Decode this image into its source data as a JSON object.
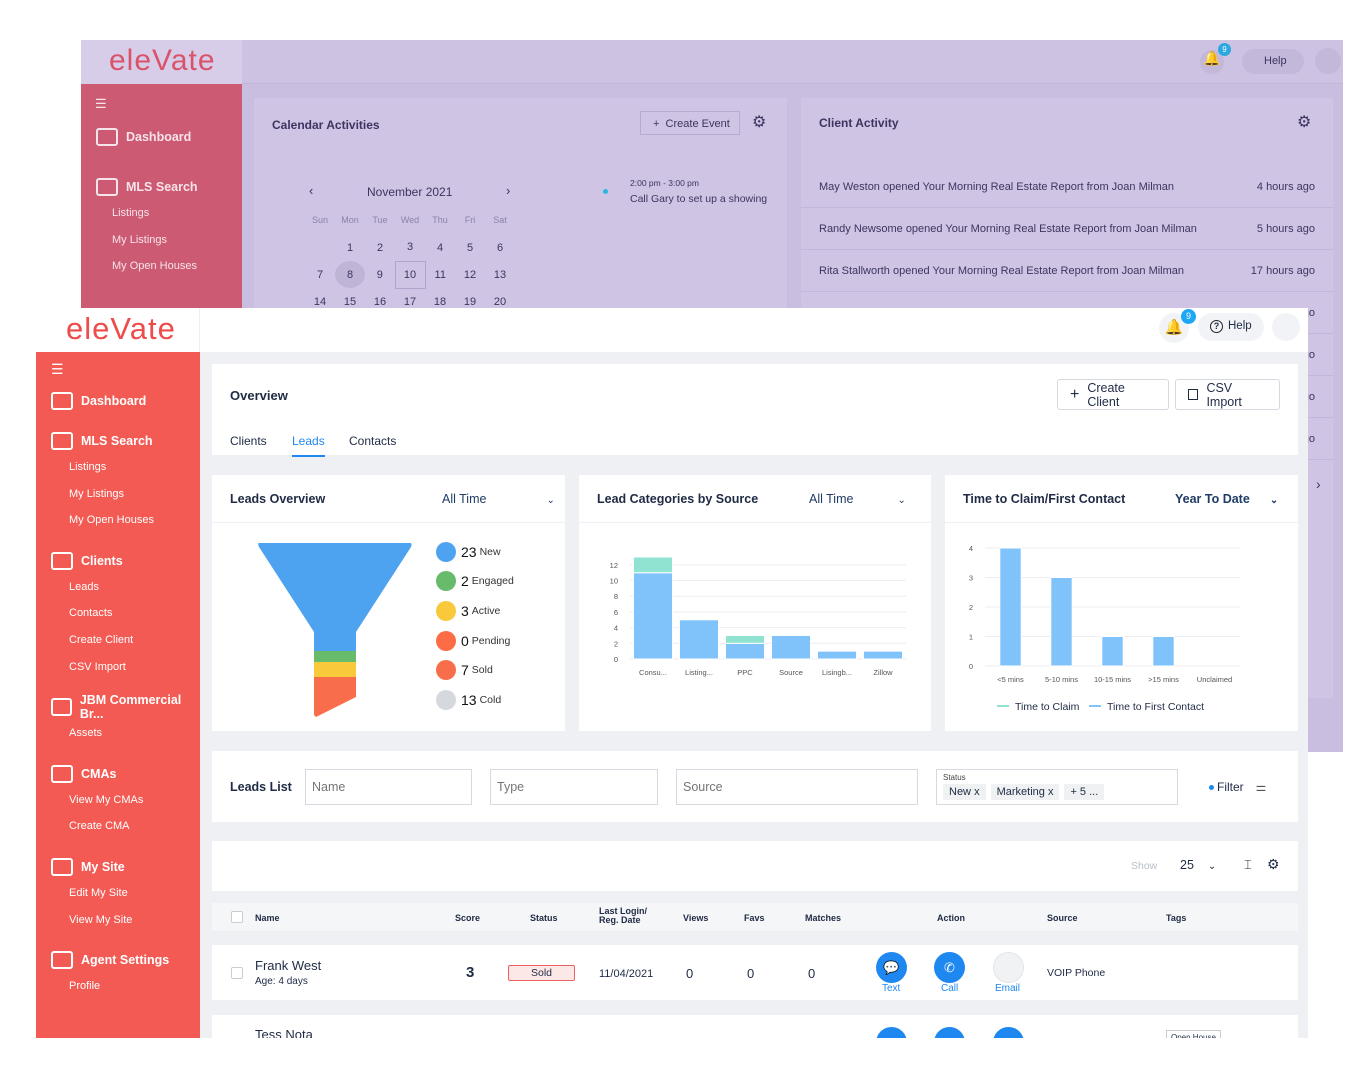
{
  "background_window": {
    "logo": "eleVate",
    "notifications": "9",
    "help": "Help",
    "sidebar": {
      "dashboard": "Dashboard",
      "mls": "MLS Search",
      "items": [
        "Listings",
        "My Listings",
        "My Open Houses"
      ]
    },
    "calendar": {
      "title": "Calendar Activities",
      "create_event": "Create Event",
      "month": "November 2021",
      "weekdays": [
        "Sun",
        "Mon",
        "Tue",
        "Wed",
        "Thu",
        "Fri",
        "Sat"
      ],
      "weeks": [
        [
          "",
          "1",
          "2",
          "3",
          "4",
          "5",
          "6"
        ],
        [
          "7",
          "8",
          "9",
          "10",
          "11",
          "12",
          "13"
        ],
        [
          "14",
          "15",
          "16",
          "17",
          "18",
          "19",
          "20"
        ]
      ],
      "event_time": "2:00 pm - 3:00 pm",
      "event_text": "Call Gary to set up a showing"
    },
    "client_activity": {
      "title": "Client Activity",
      "rows": [
        {
          "text": "May Weston opened Your Morning Real Estate Report from Joan Milman",
          "time": "4 hours ago"
        },
        {
          "text": "Randy Newsome opened Your Morning Real Estate Report from Joan Milman",
          "time": "5 hours ago"
        },
        {
          "text": "Rita Stallworth opened Your Morning Real Estate Report from Joan Milman",
          "time": "17 hours ago"
        },
        {
          "text": "",
          "time": "go"
        },
        {
          "text": "",
          "time": "go"
        },
        {
          "text": "",
          "time": "go"
        },
        {
          "text": "",
          "time": "go"
        }
      ]
    }
  },
  "header": {
    "logo": "eleVate",
    "notifications": "9",
    "help": "Help"
  },
  "sidebar": {
    "sections": [
      {
        "label": "Dashboard",
        "items": []
      },
      {
        "label": "MLS Search",
        "items": [
          "Listings",
          "My Listings",
          "My Open Houses"
        ]
      },
      {
        "label": "Clients",
        "items": [
          "Leads",
          "Contacts",
          "Create Client",
          "CSV Import"
        ]
      },
      {
        "label": "JBM Commercial Br...",
        "items": [
          "Assets"
        ]
      },
      {
        "label": "CMAs",
        "items": [
          "View My CMAs",
          "Create CMA"
        ]
      },
      {
        "label": "My Site",
        "items": [
          "Edit My Site",
          "View My Site"
        ]
      },
      {
        "label": "Agent Settings",
        "items": [
          "Profile"
        ]
      }
    ]
  },
  "overview": {
    "title": "Overview",
    "create_client": "Create Client",
    "csv_import": "CSV Import",
    "tabs": [
      "Clients",
      "Leads",
      "Contacts"
    ],
    "active_tab": "Leads"
  },
  "leads_overview": {
    "title": "Leads Overview",
    "range": "All Time",
    "stages": [
      {
        "count": "23",
        "label": "New",
        "color": "#4da3f0"
      },
      {
        "count": "2",
        "label": "Engaged",
        "color": "#67bb6a"
      },
      {
        "count": "3",
        "label": "Active",
        "color": "#f9c93c"
      },
      {
        "count": "0",
        "label": "Pending",
        "color": "#fc6d45"
      },
      {
        "count": "7",
        "label": "Sold",
        "color": "#f96e4a"
      },
      {
        "count": "13",
        "label": "Cold",
        "color": "#d5d8dd"
      }
    ]
  },
  "chart_data": [
    {
      "type": "bar",
      "title": "Lead Categories by Source",
      "range": "All Time",
      "stacked": true,
      "categories": [
        "Consu...",
        "Listing...",
        "PPC",
        "Source",
        "Lisingb...",
        "Zillow"
      ],
      "series": [
        {
          "values": [
            11,
            5,
            2,
            3,
            1,
            1
          ],
          "color": "#80c3fb"
        },
        {
          "values": [
            2,
            0,
            1,
            0,
            0,
            0
          ],
          "color": "#8fe3d0"
        }
      ],
      "yticks": [
        "0",
        "2",
        "4",
        "6",
        "8",
        "10",
        "12"
      ],
      "ylim": [
        0,
        13
      ],
      "grid": true
    },
    {
      "type": "bar",
      "title": "Time to Claim/First Contact",
      "range": "Year To Date",
      "categories": [
        "<5 mins",
        "5-10 mins",
        "10-15 mins",
        ">15 mins",
        "Unclaimed"
      ],
      "series": [
        {
          "name": "Time to Claim",
          "values": [
            0,
            0,
            0,
            0,
            0
          ],
          "color": "#8fe3d0"
        },
        {
          "name": "Time to First Contact",
          "values": [
            4,
            3,
            1,
            1,
            0
          ],
          "color": "#80c3fb"
        }
      ],
      "yticks": [
        "0",
        "1",
        "2",
        "3",
        "4"
      ],
      "ylim": [
        0,
        4
      ],
      "grid": true,
      "legend": "bottom"
    }
  ],
  "leads_list": {
    "title": "Leads List",
    "name_ph": "Name",
    "type_ph": "Type",
    "source_ph": "Source",
    "status_label": "Status",
    "status_tags": [
      "New",
      "Marketing",
      "+ 5 ..."
    ],
    "filter": "Filter"
  },
  "table": {
    "show": "Show",
    "page_size": "25",
    "columns": [
      "Name",
      "Score",
      "Status",
      "Last Login/ Reg. Date",
      "Views",
      "Favs",
      "Matches",
      "Action",
      "Source",
      "Tags"
    ],
    "rows": [
      {
        "name": "Frank West",
        "age": "Age: 4 days",
        "score": "3",
        "status": "Sold",
        "date": "11/04/2021",
        "views": "0",
        "favs": "0",
        "matches": "0",
        "source": "VOIP Phone"
      },
      {
        "name": "Tess Nota",
        "tag": "Open House"
      }
    ],
    "actions": [
      "Text",
      "Call",
      "Email"
    ]
  }
}
